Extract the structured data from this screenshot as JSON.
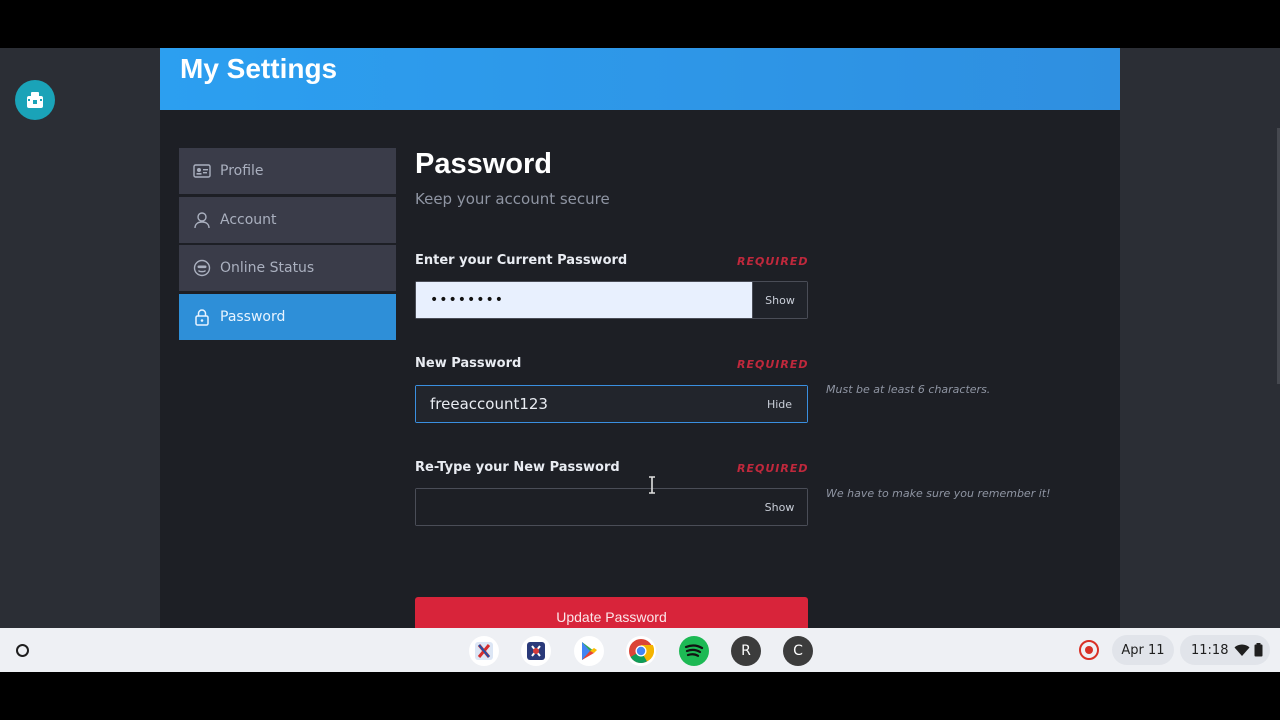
{
  "header": {
    "title": "My Settings"
  },
  "nav": {
    "items": [
      {
        "label": "Profile",
        "icon": "id-card-icon"
      },
      {
        "label": "Account",
        "icon": "user-icon"
      },
      {
        "label": "Online Status",
        "icon": "smiley-icon"
      },
      {
        "label": "Password",
        "icon": "lock-icon",
        "active": true
      }
    ]
  },
  "section": {
    "title": "Password",
    "subtitle": "Keep your account secure"
  },
  "fields": [
    {
      "label": "Enter your Current Password",
      "required": "REQUIRED",
      "value": "••••••••",
      "toggle": "Show",
      "hint": ""
    },
    {
      "label": "New Password",
      "required": "REQUIRED",
      "value": "freeaccount123",
      "toggle": "Hide",
      "hint": "Must be at least 6 characters."
    },
    {
      "label": "Re-Type your New Password",
      "required": "REQUIRED",
      "value": "",
      "toggle": "Show",
      "hint": "We have to make sure you remember it!"
    }
  ],
  "submit": {
    "label": "Update Password"
  },
  "colors": {
    "accent": "#2e8fd8",
    "danger": "#d8243a",
    "header": "#2c9ff0"
  },
  "shelf": {
    "apps": [
      {
        "name": "x-app-icon",
        "glyph": "X",
        "color": "#ffffff"
      },
      {
        "name": "game-app-icon",
        "glyph": "",
        "color": "#ffffff"
      },
      {
        "name": "play-store-icon",
        "glyph": "",
        "color": "#ffffff"
      },
      {
        "name": "chrome-icon",
        "glyph": "",
        "color": "#ffffff"
      },
      {
        "name": "spotify-icon",
        "glyph": "",
        "color": "#1db954"
      },
      {
        "name": "avatar-r-icon",
        "glyph": "R",
        "color": "#3c3c3c"
      },
      {
        "name": "avatar-c-icon",
        "glyph": "C",
        "color": "#3c3c3c"
      }
    ],
    "date": "Apr 11",
    "time": "11:18"
  }
}
